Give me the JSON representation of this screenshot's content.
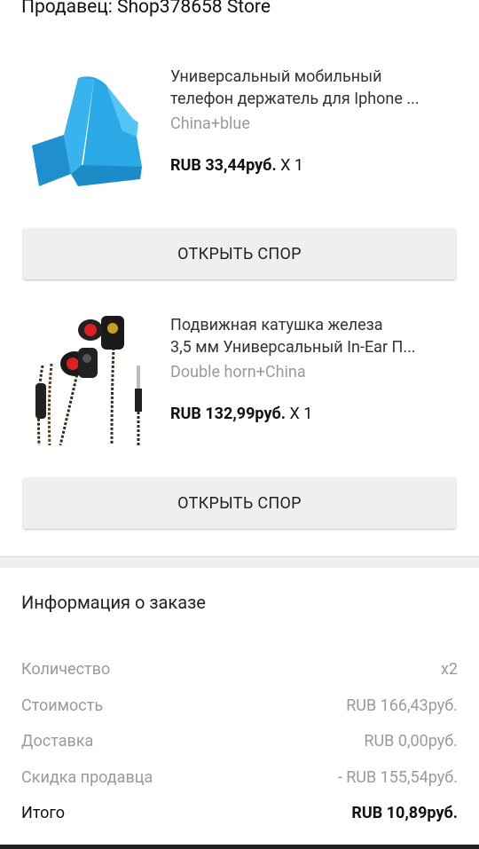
{
  "seller": {
    "label": "Продавец: Shop378658 Store"
  },
  "products": [
    {
      "title_line1": "Универсальный мобильный",
      "title_line2": "телефон держатель для Iphone ...",
      "variant": "China+blue",
      "price": "RUB 33,44руб.",
      "qty": "X 1",
      "dispute_label": "ОТКРЫТЬ СПОР",
      "image": "blue-phone-stand",
      "accent": "#2aa9e6"
    },
    {
      "title_line1": "Подвижная катушка железа",
      "title_line2": "3,5 мм Универсальный In-Ear П...",
      "variant": "Double horn+China",
      "price": "RUB 132,99руб.",
      "qty": "X 1",
      "dispute_label": "ОТКРЫТЬ СПОР",
      "image": "earphones",
      "accent": "#e02020"
    }
  ],
  "order_info": {
    "title": "Информация о заказе",
    "rows": [
      {
        "label": "Количество",
        "value": "x2"
      },
      {
        "label": "Стоимость",
        "value": "RUB 166,43руб."
      },
      {
        "label": "Доставка",
        "value": "RUB 0,00руб."
      },
      {
        "label": "Скидка продавца",
        "value": "- RUB 155,54руб."
      }
    ],
    "total": {
      "label": "Итого",
      "value": "RUB 10,89руб."
    }
  }
}
